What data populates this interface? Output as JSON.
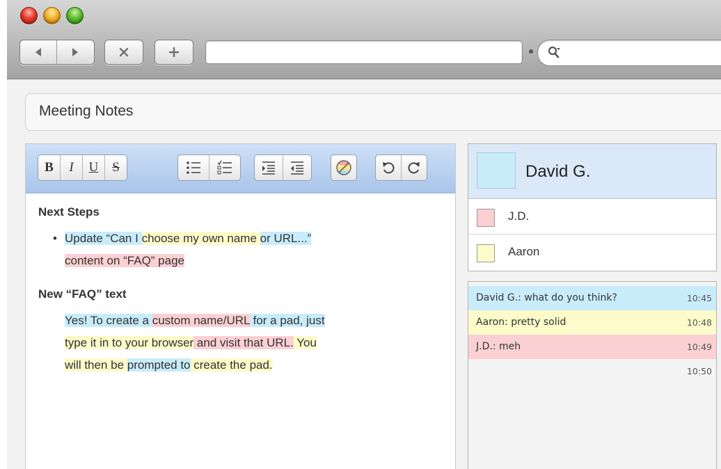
{
  "browser": {
    "nav_back_icon": "triangle-left-icon",
    "nav_forward_icon": "triangle-right-icon",
    "stop_icon": "x-icon",
    "new_tab_icon": "plus-icon",
    "search_icon": "magnifier-icon",
    "url_value": "",
    "search_value": ""
  },
  "document": {
    "title": "Meeting Notes"
  },
  "toolbar": {
    "bold": "B",
    "italic": "I",
    "underline": "U",
    "strike": "S",
    "icons": [
      "bold-icon",
      "italic-icon",
      "underline-icon",
      "strikethrough-icon",
      "bullet-list-icon",
      "checklist-icon",
      "indent-icon",
      "outdent-icon",
      "clear-authorship-colors-icon",
      "undo-icon",
      "redo-icon"
    ]
  },
  "content": {
    "heading1": "Next Steps",
    "bullet": "•",
    "b1_seg1": "Update “Can I ",
    "b1_seg2": "choose my own name ",
    "b1_seg3": "or URL...”",
    "b1_seg4": "content on “FAQ” page",
    "heading2": "New “FAQ” text",
    "p_seg1": "Yes! To create a ",
    "p_seg2": "custom name/URL",
    "p_seg3": " for a pad, just",
    "p_seg4": "type it in to your browser",
    "p_seg5": " and visit that URL.",
    "p_seg6": " You",
    "p_seg7": "will then be ",
    "p_seg8": "prompted to",
    "p_seg9": " create the pad."
  },
  "users": {
    "me": {
      "name": "David G.",
      "color": "#c8ecfa"
    },
    "others": [
      {
        "name": "J.D.",
        "color": "#fbd0d3"
      },
      {
        "name": "Aaron",
        "color": "#fdfbc9"
      }
    ]
  },
  "chat": {
    "messages": [
      {
        "text": "David G.: what do you think?",
        "time": "10:45",
        "color": "#c8ecfa"
      },
      {
        "text": "Aaron: pretty solid",
        "time": "10:48",
        "color": "#fdfbc9"
      },
      {
        "text": "J.D.: meh",
        "time": "10:49",
        "color": "#fbd0d3"
      },
      {
        "text": "",
        "time": "10:50",
        "color": "#f4f4f4"
      }
    ]
  }
}
